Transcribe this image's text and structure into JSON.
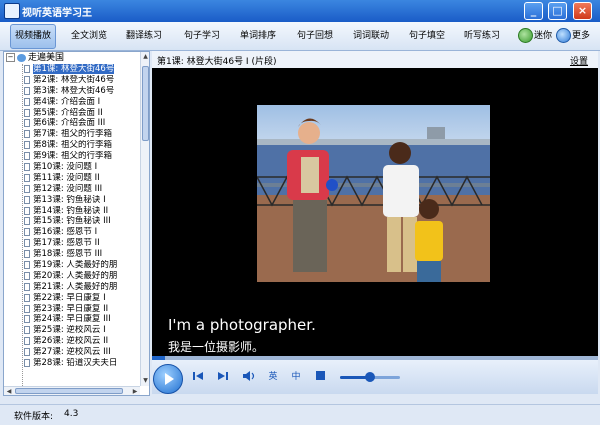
{
  "window": {
    "title": "视听英语学习王",
    "minimize": "_",
    "maximize": "□",
    "close": "×"
  },
  "toolbar": {
    "items": [
      "视频播放",
      "全文浏览",
      "翻译练习",
      "句子学习",
      "单词排序",
      "句子回想",
      "词词联动",
      "句子填空",
      "听写练习"
    ],
    "active": "视频播放",
    "mini": "迷你",
    "more": "更多"
  },
  "tree": {
    "expander": "−",
    "root": "走遍美国",
    "items": [
      "第1课: 林登大街46号",
      "第2课: 林登大街46号",
      "第3课: 林登大街46号",
      "第4课: 介绍会面 I",
      "第5课: 介绍会面 II",
      "第6课: 介绍会面 III",
      "第7课: 祖父的行李箱",
      "第8课: 祖父的行李箱",
      "第9课: 祖父的行李箱",
      "第10课: 没问题 I",
      "第11课: 没问题 II",
      "第12课: 没问题 III",
      "第13课: 钓鱼秘诀 I",
      "第14课: 钓鱼秘诀 II",
      "第15课: 钓鱼秘诀 III",
      "第16课: 感恩节 I",
      "第17课: 感恩节 II",
      "第18课: 感恩节 III",
      "第19课: 人类最好的朋",
      "第20课: 人类最好的朋",
      "第21课: 人类最好的朋",
      "第22课: 早日康复 I",
      "第23课: 早日康复 II",
      "第24课: 早日康复 III",
      "第25课: 逆校风云 I",
      "第26课: 逆校风云 II",
      "第27课: 逆校风云 III",
      "第28课: 铅道汉夫夫日"
    ],
    "selected_index": 0
  },
  "lesson": {
    "title": "第1课: 林登大街46号 I (片段)",
    "settings": "设置"
  },
  "subtitles": {
    "en": "I'm a photographer.",
    "cn": "我是一位摄影师。"
  },
  "player": {
    "english_btn": "英",
    "chinese_btn": "中",
    "progress": 0.03,
    "volume": 0.5
  },
  "status": {
    "label": "软件版本:",
    "version": "4.3"
  },
  "colors": {
    "titlebar": "#1a5cc7",
    "selection": "#316ac5",
    "accent": "#1a57b8"
  }
}
